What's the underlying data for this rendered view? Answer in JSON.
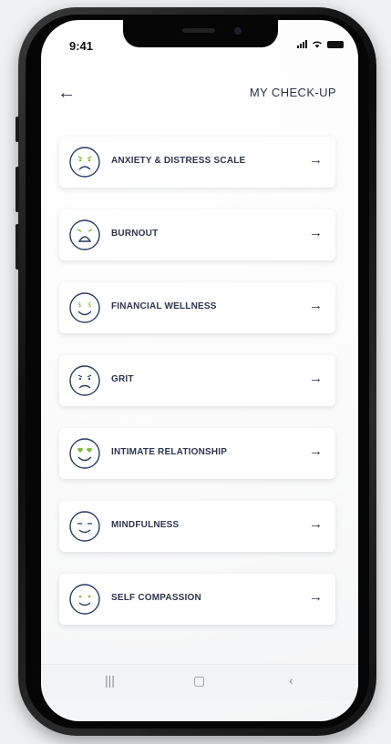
{
  "status": {
    "time": "9:41"
  },
  "header": {
    "title": "MY CHECK-UP"
  },
  "icons": {
    "back": "arrow-left-icon",
    "row_arrow": "arrow-right-icon",
    "nav_recent": "recent-apps-icon",
    "nav_home": "home-icon",
    "nav_back": "back-chevron-icon"
  },
  "colors": {
    "accent_green": "#7dbf3a",
    "face_navy": "#2b3a63",
    "text": "#2c3550"
  },
  "assessments": [
    {
      "label": "ANXIETY & DISTRESS SCALE",
      "face": "anxious-face-icon"
    },
    {
      "label": "BURNOUT",
      "face": "burnout-face-icon"
    },
    {
      "label": "FINANCIAL WELLNESS",
      "face": "money-eyes-face-icon"
    },
    {
      "label": "GRIT",
      "face": "frowning-face-icon"
    },
    {
      "label": "INTIMATE RELATIONSHIP",
      "face": "heart-eyes-face-icon"
    },
    {
      "label": "MINDFULNESS",
      "face": "calm-face-icon"
    },
    {
      "label": "SELF COMPASSION",
      "face": "content-face-icon"
    }
  ]
}
